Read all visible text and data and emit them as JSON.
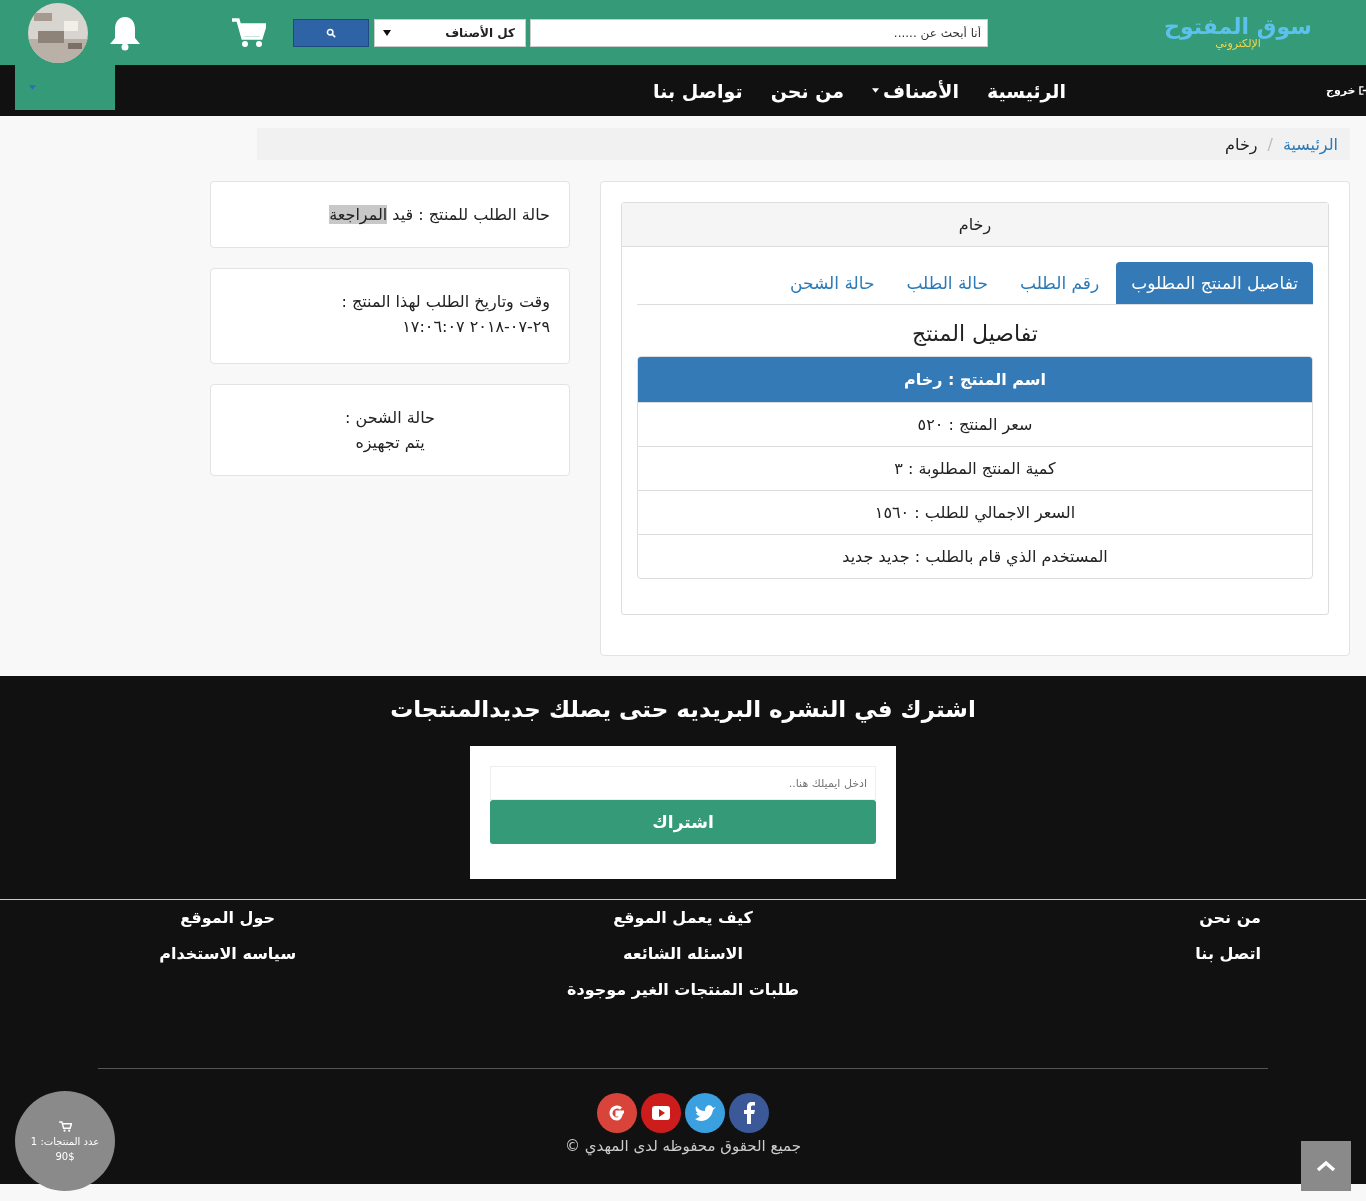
{
  "header": {
    "logo": {
      "line1": "سوق المفتوح",
      "line2": "الإلكتروني"
    },
    "search": {
      "placeholder": "أنا أبحث عن ......"
    },
    "category_select": {
      "value": "كل الأصناف"
    }
  },
  "nav": {
    "items": [
      {
        "label": "الرئيسية",
        "dropdown": false
      },
      {
        "label": "الأصناف",
        "dropdown": true
      },
      {
        "label": "من نحن",
        "dropdown": false
      },
      {
        "label": "تواصل بنا",
        "dropdown": false
      }
    ],
    "logout": "خروج"
  },
  "breadcrumb": {
    "separator": "/",
    "items": [
      {
        "label": "الرئيسية",
        "link": true
      },
      {
        "label": "رخام",
        "link": false
      }
    ]
  },
  "product_panel": {
    "title": "رخام",
    "tabs": [
      {
        "label": "تفاصيل المنتج المطلوب",
        "selected": true
      },
      {
        "label": "رقم الطلب",
        "selected": false
      },
      {
        "label": "حالة الطلب",
        "selected": false
      },
      {
        "label": "حالة الشحن",
        "selected": false
      }
    ],
    "heading": "تفاصيل المنتج",
    "rows": [
      {
        "kind": "header",
        "text": "اسم المنتج : رخام"
      },
      {
        "kind": "row",
        "text": "سعر المنتج : ٥٢٠"
      },
      {
        "kind": "row",
        "text": "كمية المنتج المطلوبة : ٣"
      },
      {
        "kind": "row",
        "text": "السعر الاجمالي للطلب : ١٥٦٠"
      },
      {
        "kind": "row",
        "text": "المستخدم الذي قام بالطلب : جديد جديد"
      }
    ]
  },
  "side_cards": [
    {
      "kind": "status",
      "text": "حالة الطلب للمنتج : قيد",
      "highlight": "المراجعة"
    },
    {
      "kind": "datetime",
      "label": "وقت وتاريخ الطلب لهذا المنتج :",
      "value": "١٧:٠٦:٠٧ ٢٠١٨-٠٧-٢٩"
    },
    {
      "kind": "centered",
      "label": "حالة الشحن :",
      "value": "يتم تجهيزه"
    }
  ],
  "newsletter": {
    "title": "اشترك في النشره البريديه حتى يصلك جديدالمنتجات",
    "placeholder": "ادخل ايميلك هنا..",
    "button": "اشتراك"
  },
  "footer_links": [
    [
      "من نحن",
      "اتصل بنا"
    ],
    [
      "كيف يعمل الموقع",
      "الاسئله الشائعه",
      "طلبات المنتجات الغير موجودة"
    ],
    [
      "حول الموقع",
      "سياسه الاستخدام"
    ]
  ],
  "copyright": "جميع الحقوق محفوظه لدى المهدي ©",
  "cart_widget": {
    "count": "عدد المنتجات: 1",
    "total": "90$"
  }
}
